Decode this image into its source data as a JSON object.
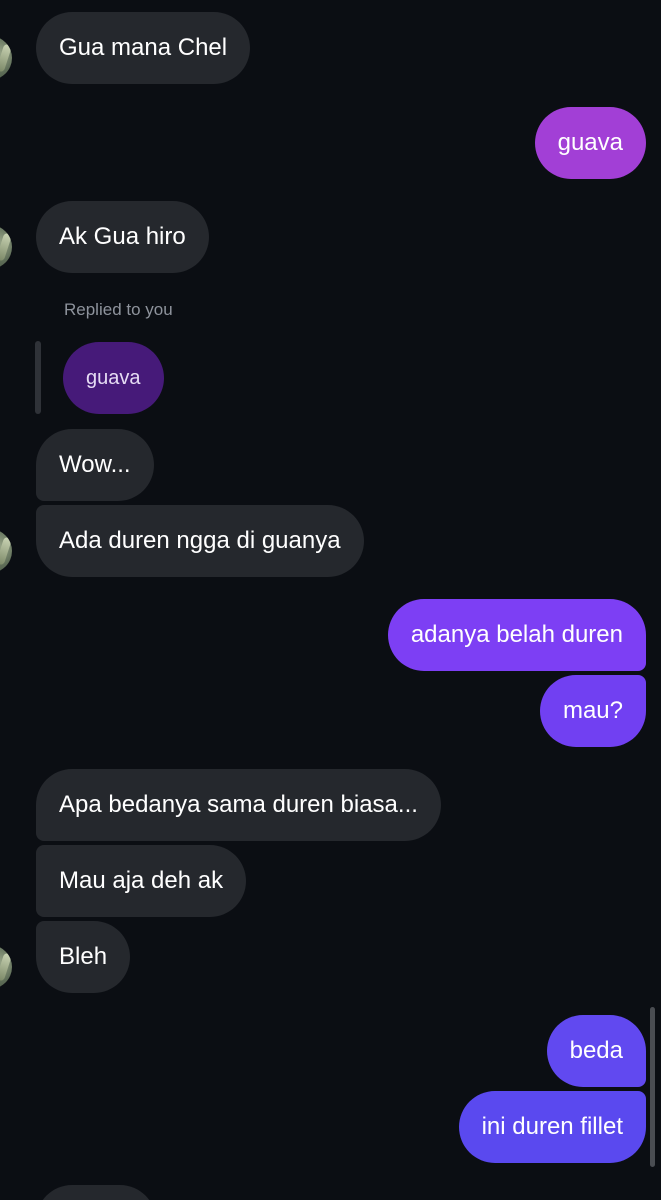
{
  "messages": [
    {
      "text": "Gua mana Chel"
    },
    {
      "text": "guava"
    },
    {
      "text": "Ak Gua hiro"
    },
    {
      "text": "Wow..."
    },
    {
      "text": "Ada duren ngga di guanya"
    },
    {
      "text": "adanya belah duren"
    },
    {
      "text": "mau?"
    },
    {
      "text": "Apa bedanya sama duren biasa..."
    },
    {
      "text": "Mau aja deh ak"
    },
    {
      "text": "Bleh"
    },
    {
      "text": "beda"
    },
    {
      "text": "ini duren fillet"
    },
    {
      "text": ""
    }
  ],
  "reply": {
    "label": "Replied to you",
    "quoted_text": "guava"
  },
  "colors": {
    "background": "#0b0e13",
    "incoming_bubble": "#25282d",
    "outgoing_gradient_top": "#a23fd6",
    "outgoing_gradient_bottom": "#5a49ef",
    "reply_preview": "#461a79"
  }
}
